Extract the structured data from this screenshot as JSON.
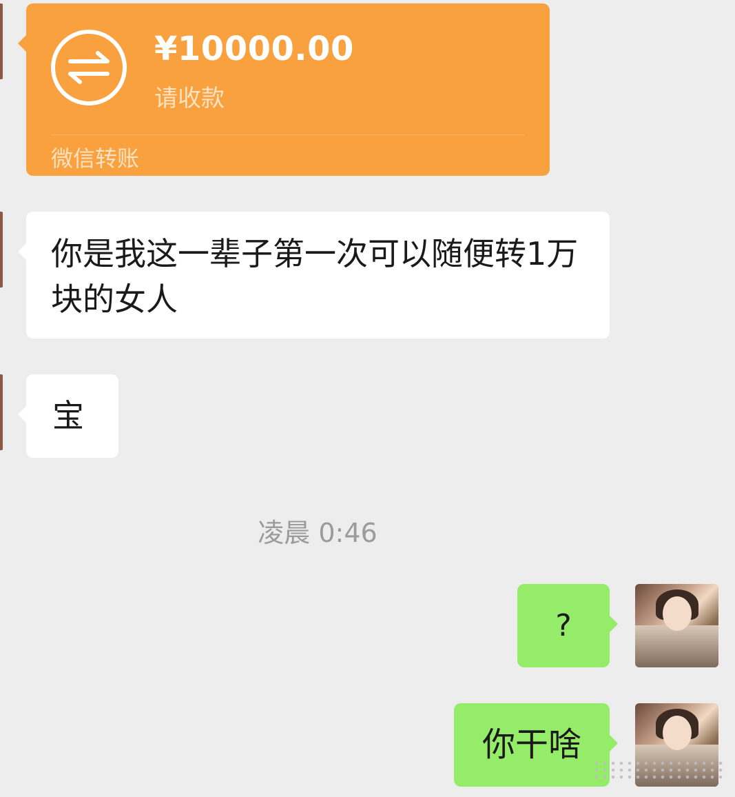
{
  "transfer": {
    "amount": "¥10000.00",
    "status": "请收款",
    "footer": "微信转账",
    "icon": "transfer-icon",
    "color": "#f9a03f"
  },
  "messages_in": [
    {
      "text": "你是我这一辈子第一次可以随便转1万块的女人"
    },
    {
      "text": "宝"
    }
  ],
  "timestamp": "凌晨 0:46",
  "messages_out": [
    {
      "text": "?"
    },
    {
      "text": "你干啥"
    }
  ],
  "colors": {
    "background": "#ededed",
    "bubble_in": "#ffffff",
    "bubble_out": "#95ec69"
  }
}
